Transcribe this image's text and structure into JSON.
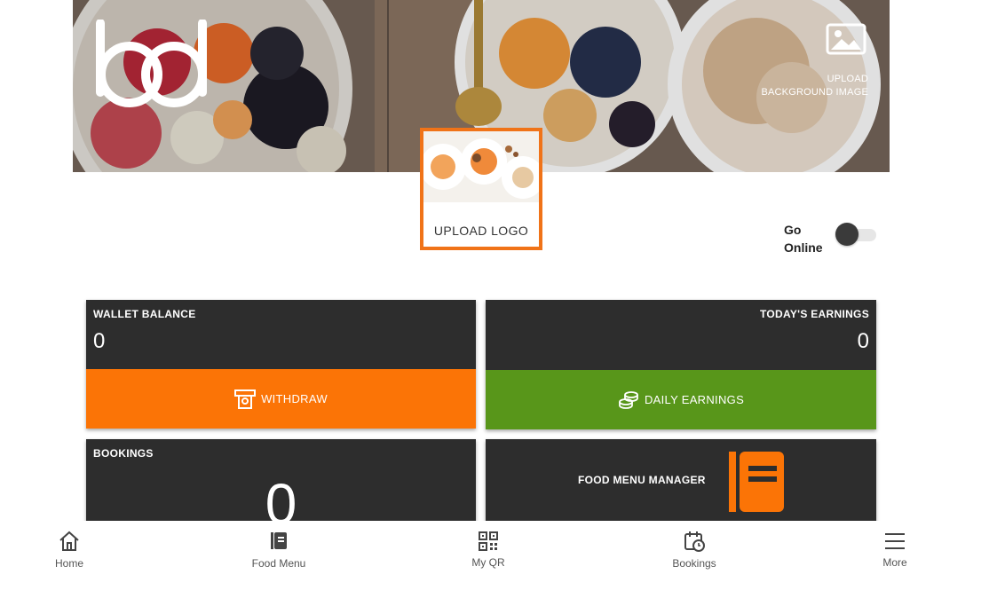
{
  "banner": {
    "upload_bg_line1": "UPLOAD",
    "upload_bg_line2": "BACKGROUND IMAGE"
  },
  "logo_upload": {
    "label": "UPLOAD LOGO"
  },
  "status": {
    "go_online_label": "Go Online",
    "online": false
  },
  "cards": {
    "wallet": {
      "title": "WALLET BALANCE",
      "value": "0",
      "action": "WITHDRAW"
    },
    "earnings": {
      "title": "TODAY'S EARNINGS",
      "value": "0",
      "action": "DAILY EARNINGS"
    },
    "bookings": {
      "title": "BOOKINGS",
      "value": "0"
    },
    "food_menu_manager": {
      "title": "FOOD MENU MANAGER"
    }
  },
  "bottom_nav": [
    {
      "label": "Home",
      "icon": "home-icon"
    },
    {
      "label": "Food Menu",
      "icon": "book-icon"
    },
    {
      "label": "My QR",
      "icon": "qr-icon"
    },
    {
      "label": "Bookings",
      "icon": "calendar-clock-icon"
    },
    {
      "label": "More",
      "icon": "hamburger-icon"
    }
  ],
  "colors": {
    "accent_orange": "#fb7406",
    "earnings_green": "#58961a",
    "card_dark": "#2d2d2d",
    "logo_border": "#f07318"
  }
}
